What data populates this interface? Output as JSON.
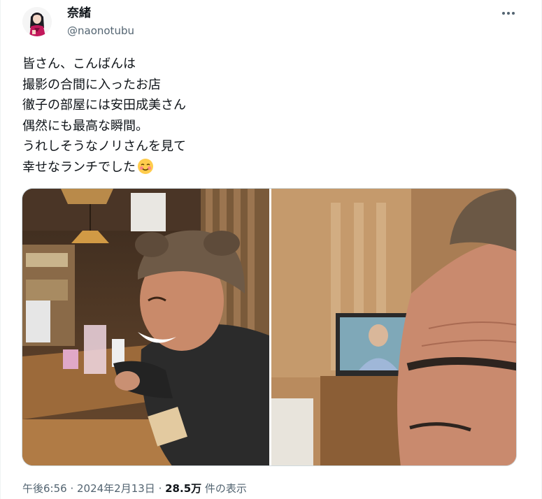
{
  "author": {
    "display_name": "奈緒",
    "handle": "@naonotubu"
  },
  "tweet": {
    "lines": [
      "皆さん、こんばんは",
      "撮影の合間に入ったお店",
      "徹子の部屋には安田成美さん",
      "偶然にも最高な瞬間。",
      "うれしそうなノリさんを見て",
      "幸せなランチでした"
    ],
    "emoji": "smiling-face-with-blush-emoji"
  },
  "media": {
    "photos": [
      {
        "name": "restaurant-laughing-man-photo"
      },
      {
        "name": "tv-closeup-eyebrow-photo"
      }
    ]
  },
  "meta": {
    "time": "午後6:56",
    "separator1": " · ",
    "date": "2024年2月13日",
    "separator2": " · ",
    "views_count": "28.5万",
    "views_label": " 件の表示"
  },
  "icons": {
    "more": "more-horizontal-icon"
  }
}
